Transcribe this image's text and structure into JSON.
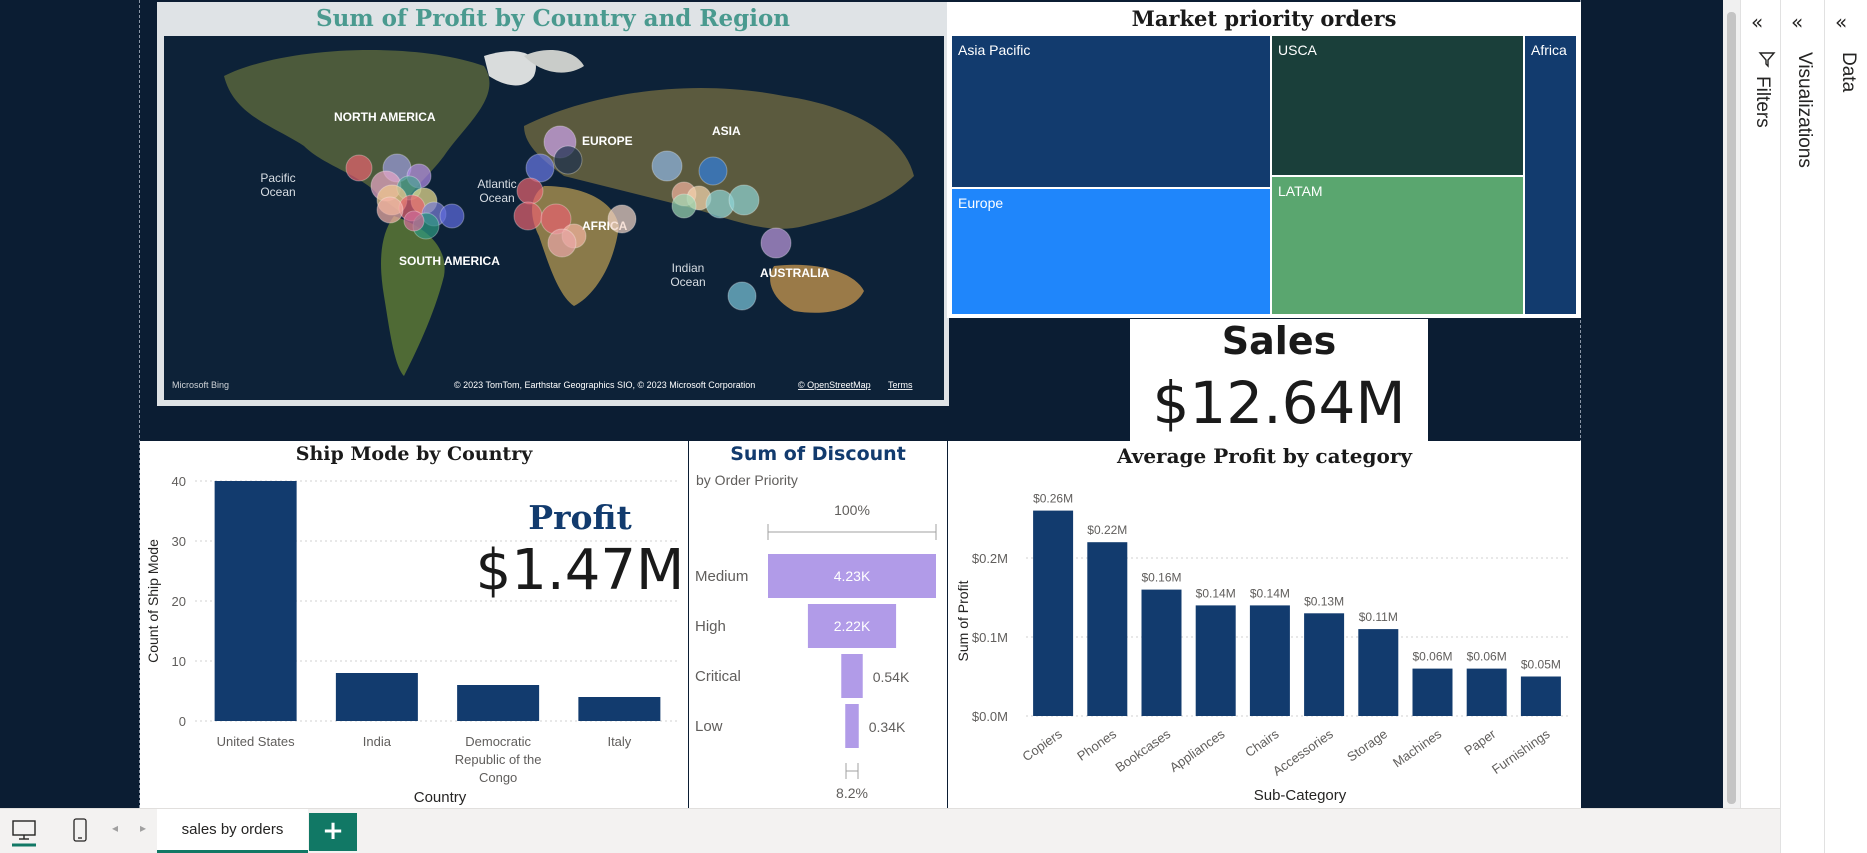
{
  "map_visual": {
    "title": "Sum of Profit by Country and Region",
    "labels": {
      "north_america": "NORTH AMERICA",
      "south_america": "SOUTH AMERICA",
      "europe": "EUROPE",
      "asia": "ASIA",
      "africa": "AFRICA",
      "australia": "AUSTRALIA",
      "pacific": "Pacific\nOcean",
      "atlantic": "Atlantic\nOcean",
      "indian": "Indian\nOcean"
    },
    "bing": "Microsoft Bing",
    "copyright": "© 2023 TomTom, Earthstar Geographics SIO, © 2023 Microsoft Corporation",
    "osm": "© OpenStreetMap",
    "terms": "Terms"
  },
  "treemap": {
    "title": "Market priority orders",
    "cells": [
      {
        "label": "Asia Pacific",
        "color": "#123b6e"
      },
      {
        "label": "Europe",
        "color": "#1f86fb"
      },
      {
        "label": "USCA",
        "color": "#1a3f3a"
      },
      {
        "label": "LATAM",
        "color": "#5aa66f"
      },
      {
        "label": "Africa",
        "color": "#123b6e"
      }
    ]
  },
  "sales_card": {
    "label": "Sales",
    "value": "$12.64M"
  },
  "profit_card": {
    "label": "Profit",
    "value": "$1.47M"
  },
  "ship_chart": {
    "title": "Ship Mode by Country",
    "ylabel": "Count of Ship Mode",
    "xlabel": "Country",
    "y_ticks": [
      "40",
      "30",
      "20",
      "10",
      "0"
    ],
    "x_labels": [
      "United States",
      "India",
      "Democratic Republic of the Congo",
      "Italy"
    ]
  },
  "discount_chart": {
    "title": "Sum of Discount",
    "subtitle": "by Order Priority",
    "top_label": "100%",
    "bottom_label": "8.2%",
    "labels": [
      "Medium",
      "High",
      "Critical",
      "Low"
    ],
    "values": [
      "4.23K",
      "2.22K",
      "0.54K",
      "0.34K"
    ]
  },
  "avg_chart": {
    "title": "Average Profit by category",
    "ylabel": "Sum of Profit",
    "xlabel": "Sub-Category",
    "y_ticks": [
      "$0.2M",
      "$0.1M",
      "$0.0M"
    ],
    "data_labels": [
      "$0.26M",
      "$0.22M",
      "$0.16M",
      "$0.14M",
      "$0.14M",
      "$0.13M",
      "$0.11M",
      "$0.06M",
      "$0.06M",
      "$0.05M"
    ]
  },
  "chart_data": [
    {
      "type": "bar",
      "title": "Ship Mode by Country",
      "xlabel": "Country",
      "ylabel": "Count of Ship Mode",
      "categories": [
        "United States",
        "India",
        "Democratic Republic of the Congo",
        "Italy"
      ],
      "values": [
        40,
        8,
        6,
        4
      ],
      "ylim": [
        0,
        40
      ]
    },
    {
      "type": "bar",
      "title": "Sum of Discount",
      "categories": [
        "Medium",
        "High",
        "Critical",
        "Low"
      ],
      "values": [
        4230,
        2220,
        540,
        340
      ]
    },
    {
      "type": "bar",
      "title": "Average Profit by category",
      "xlabel": "Sub-Category",
      "ylabel": "Sum of Profit",
      "categories": [
        "Copiers",
        "Phones",
        "Bookcases",
        "Appliances",
        "Chairs",
        "Accessories",
        "Storage",
        "Machines",
        "Paper",
        "Furnishings"
      ],
      "values": [
        0.26,
        0.22,
        0.16,
        0.14,
        0.14,
        0.13,
        0.11,
        0.06,
        0.06,
        0.05
      ],
      "ylim": [
        0,
        0.26
      ]
    }
  ],
  "panes": {
    "filters": "Filters",
    "visualizations": "Visualizations",
    "data": "Data"
  },
  "tabs": {
    "active": "sales by orders",
    "add": "+"
  },
  "colors": {
    "bar": "#123b6e",
    "funnel": "#b19be8",
    "canvas": "#0b1d33",
    "accent": "#117865"
  }
}
